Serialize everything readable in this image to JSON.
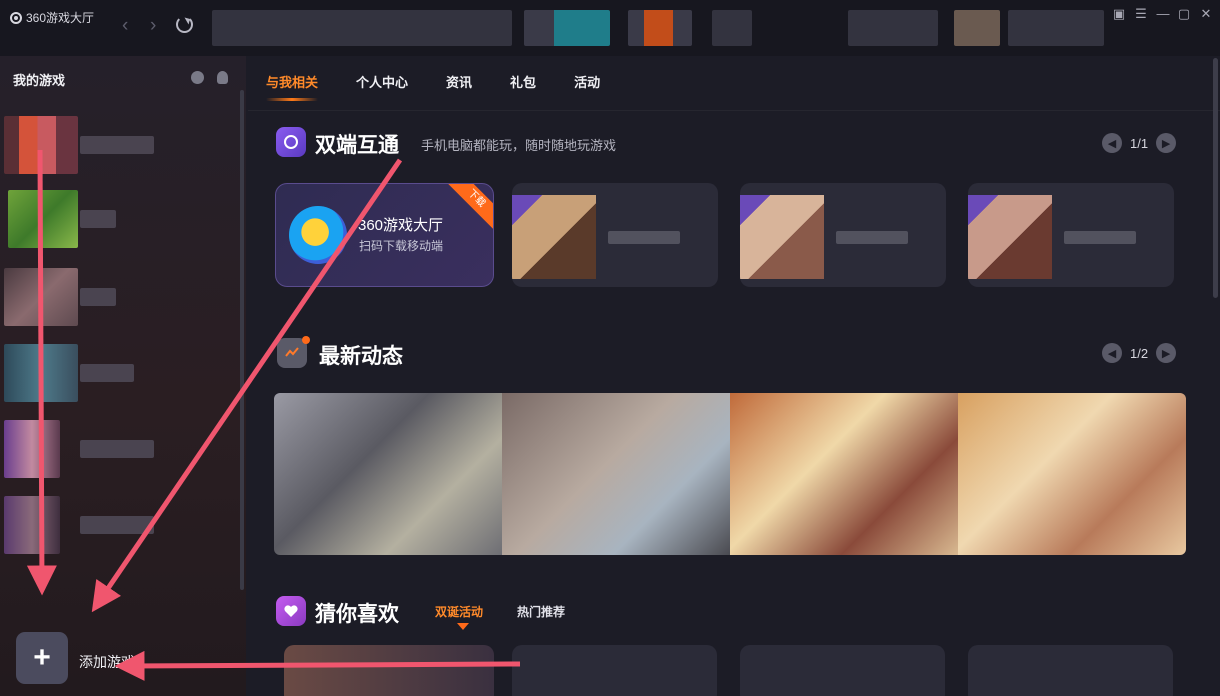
{
  "app": {
    "title": "360游戏大厅"
  },
  "sidebar": {
    "title": "我的游戏",
    "add_label": "添加游戏",
    "add_symbol": "+"
  },
  "tabs": [
    {
      "label": "与我相关"
    },
    {
      "label": "个人中心"
    },
    {
      "label": "资讯"
    },
    {
      "label": "礼包"
    },
    {
      "label": "活动"
    }
  ],
  "section_dual": {
    "title": "双端互通",
    "subtitle": "手机电脑都能玩，随时随地玩游戏",
    "page": "1/1",
    "promo": {
      "title": "360游戏大厅",
      "subtitle": "扫码下载移动端",
      "badge": "下载"
    }
  },
  "section_news": {
    "title": "最新动态",
    "page": "1/2"
  },
  "section_guess": {
    "title": "猜你喜欢",
    "tabs": [
      {
        "label": "双诞活动"
      },
      {
        "label": "热门推荐"
      }
    ]
  },
  "window_controls": {
    "feedback": "▣",
    "menu": "☰",
    "minimize": "—",
    "maximize": "▢",
    "close": "✕"
  },
  "nav": {
    "back": "‹",
    "forward": "›"
  },
  "colors": {
    "accent": "#ff8a2a",
    "annotation_arrow": "#f0566e",
    "background": "#1c1c26"
  }
}
